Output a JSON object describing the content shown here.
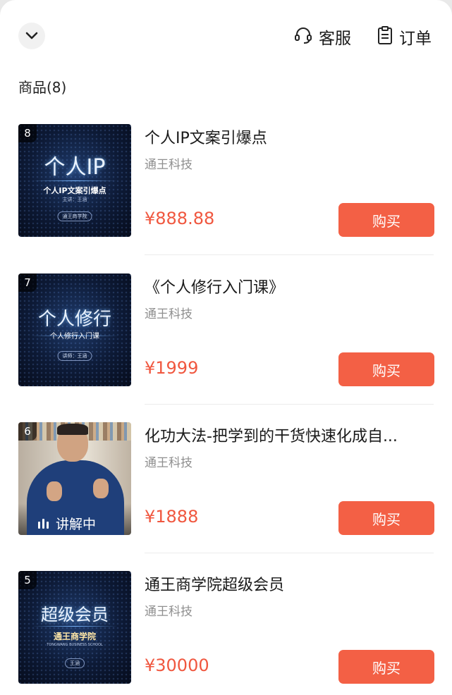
{
  "header": {
    "collapse_icon": "chevron-down-icon",
    "service_icon": "headset-icon",
    "service_label": "客服",
    "orders_icon": "clipboard-icon",
    "orders_label": "订单"
  },
  "section_title": "商品(8)",
  "colors": {
    "price": "#f0573f",
    "buy_button": "#f36045"
  },
  "products": [
    {
      "rank": "8",
      "title": "个人IP文案引爆点",
      "shop": "通王科技",
      "price": "¥888.88",
      "buy_label": "购买",
      "thumb_big": "个人IP",
      "thumb_sub": "个人IP文案引爆点",
      "thumb_small": "主讲：王涵",
      "thumb_tag": "通王商学院"
    },
    {
      "rank": "7",
      "title": "《个人修行入门课》",
      "shop": "通王科技",
      "price": "¥1999",
      "buy_label": "购买",
      "thumb_big": "个人修行",
      "thumb_sub": "个人修行入门课",
      "thumb_tag": "讲师：王涵"
    },
    {
      "rank": "6",
      "title": "化功大法-把学到的干货快速化成自...",
      "shop": "通王科技",
      "price": "¥1888",
      "buy_label": "购买",
      "live_label": "讲解中"
    },
    {
      "rank": "5",
      "title": "通王商学院超级会员",
      "shop": "通王科技",
      "price": "¥30000",
      "buy_label": "购买",
      "thumb_big": "超级会员",
      "thumb_sub": "通王商学院",
      "thumb_small": "TONGWANG BUSINESS SCHOOL",
      "thumb_tag": "王涵"
    }
  ]
}
